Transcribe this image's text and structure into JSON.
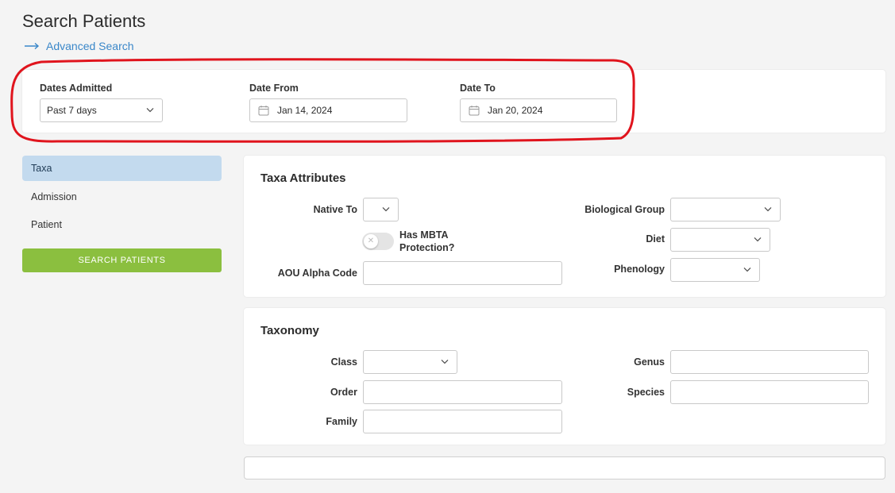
{
  "page": {
    "title": "Search Patients"
  },
  "advanced_search": {
    "label": "Advanced Search"
  },
  "dates": {
    "admitted_label": "Dates Admitted",
    "admitted_value": "Past 7 days",
    "from_label": "Date From",
    "from_value": "Jan 14, 2024",
    "to_label": "Date To",
    "to_value": "Jan 20, 2024"
  },
  "sidebar": {
    "items": [
      {
        "label": "Taxa",
        "active": true
      },
      {
        "label": "Admission",
        "active": false
      },
      {
        "label": "Patient",
        "active": false
      }
    ],
    "search_button": "SEARCH PATIENTS"
  },
  "taxa_attributes": {
    "title": "Taxa Attributes",
    "native_to_label": "Native To",
    "native_to_value": "",
    "mbta_label": "Has MBTA Protection?",
    "mbta_on": false,
    "aou_label": "AOU Alpha Code",
    "aou_value": "",
    "bio_group_label": "Biological Group",
    "bio_group_value": "",
    "diet_label": "Diet",
    "diet_value": "",
    "phenology_label": "Phenology",
    "phenology_value": ""
  },
  "taxonomy": {
    "title": "Taxonomy",
    "class_label": "Class",
    "class_value": "",
    "order_label": "Order",
    "order_value": "",
    "family_label": "Family",
    "family_value": "",
    "genus_label": "Genus",
    "genus_value": "",
    "species_label": "Species",
    "species_value": ""
  },
  "colors": {
    "accent_link": "#3a87c9",
    "active_nav": "#c3daee",
    "search_button": "#8bbf3f",
    "highlight_annotation": "#e0141d"
  },
  "icons": {
    "advanced_search": "arrow-right-icon",
    "select": "chevron-down-icon",
    "date": "calendar-icon",
    "toggle": "x-icon"
  }
}
